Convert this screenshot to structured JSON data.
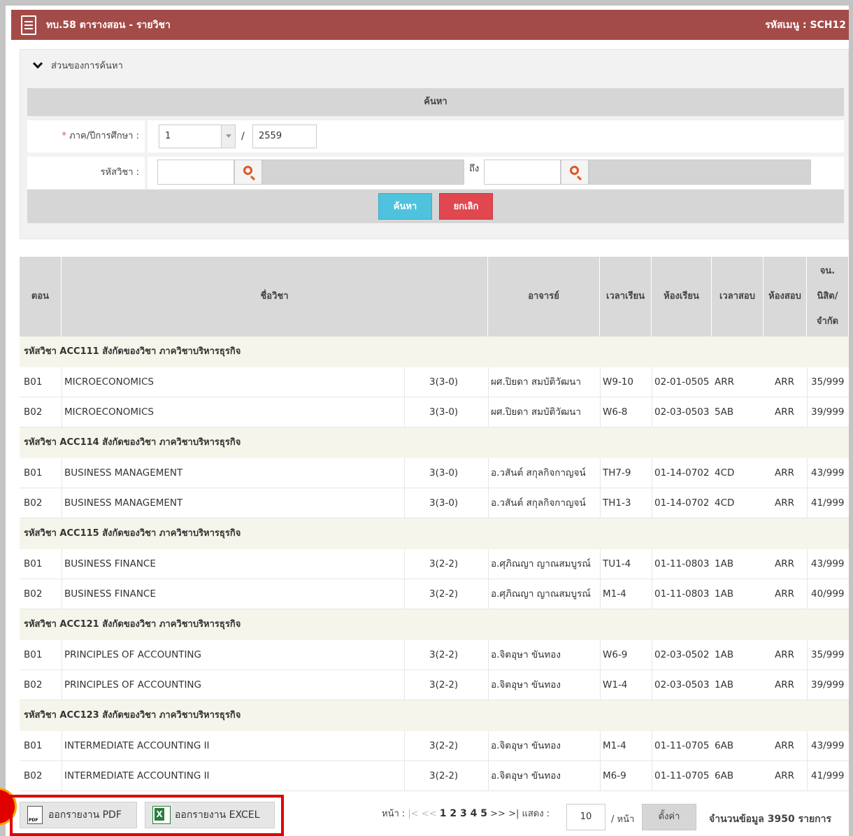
{
  "header": {
    "title": "ทบ.58 ตารางสอน - รายวิชา",
    "menu_code": "รหัสเมนู : SCH12"
  },
  "search": {
    "collapse_label": "ส่วนของการค้นหา",
    "section_title": "ค้นหา",
    "term_label": "ภาค/ปีการศึกษา :",
    "required_mark": "*",
    "term_value": "1",
    "slash": "/",
    "year_value": "2559",
    "course_code_label": "รหัสวิชา :",
    "to_label": "ถึง",
    "search_button": "ค้นหา",
    "cancel_button": "ยกเลิก"
  },
  "table": {
    "headers": {
      "section": "ตอน",
      "course_name": "ชื่อวิชา",
      "instructor": "อาจารย์",
      "class_time": "เวลาเรียน",
      "room": "ห้องเรียน",
      "exam_time": "เวลาสอบ",
      "exam_room": "ห้องสอบ",
      "count_1": "จน.",
      "count_2": "นิสิต/",
      "count_3": "จำกัด"
    },
    "groups": [
      {
        "label": "รหัสวิชา ACC111 สังกัดของวิชา ภาควิชาบริหารธุรกิจ",
        "rows": [
          {
            "sec": "B01",
            "name": "MICROECONOMICS",
            "credit": "3(3-0)",
            "teacher": "ผศ.ปิยดา สมบัติวัฒนา",
            "time": "W9-10",
            "room": "02-01-0505",
            "exam": "ARR",
            "exam_room": "ARR",
            "count": "35/999"
          },
          {
            "sec": "B02",
            "name": "MICROECONOMICS",
            "credit": "3(3-0)",
            "teacher": "ผศ.ปิยดา สมบัติวัฒนา",
            "time": "W6-8",
            "room": "02-03-0503",
            "exam": "5AB",
            "exam_room": "ARR",
            "count": "39/999"
          }
        ]
      },
      {
        "label": "รหัสวิชา ACC114 สังกัดของวิชา ภาควิชาบริหารธุรกิจ",
        "rows": [
          {
            "sec": "B01",
            "name": "BUSINESS MANAGEMENT",
            "credit": "3(3-0)",
            "teacher": "อ.วสันต์ สกุลกิจกาญจน์",
            "time": "TH7-9",
            "room": "01-14-0702",
            "exam": "4CD",
            "exam_room": "ARR",
            "count": "43/999"
          },
          {
            "sec": "B02",
            "name": "BUSINESS MANAGEMENT",
            "credit": "3(3-0)",
            "teacher": "อ.วสันต์ สกุลกิจกาญจน์",
            "time": "TH1-3",
            "room": "01-14-0702",
            "exam": "4CD",
            "exam_room": "ARR",
            "count": "41/999"
          }
        ]
      },
      {
        "label": "รหัสวิชา ACC115 สังกัดของวิชา ภาควิชาบริหารธุรกิจ",
        "rows": [
          {
            "sec": "B01",
            "name": "BUSINESS FINANCE",
            "credit": "3(2-2)",
            "teacher": "อ.ศุภิณญา ญาณสมบูรณ์",
            "time": "TU1-4",
            "room": "01-11-0803",
            "exam": "1AB",
            "exam_room": "ARR",
            "count": "43/999"
          },
          {
            "sec": "B02",
            "name": "BUSINESS FINANCE",
            "credit": "3(2-2)",
            "teacher": "อ.ศุภิณญา ญาณสมบูรณ์",
            "time": "M1-4",
            "room": "01-11-0803",
            "exam": "1AB",
            "exam_room": "ARR",
            "count": "40/999"
          }
        ]
      },
      {
        "label": "รหัสวิชา ACC121 สังกัดของวิชา ภาควิชาบริหารธุรกิจ",
        "rows": [
          {
            "sec": "B01",
            "name": "PRINCIPLES OF ACCOUNTING",
            "credit": "3(2-2)",
            "teacher": "อ.จิตอุษา ขันทอง",
            "time": "W6-9",
            "room": "02-03-0502",
            "exam": "1AB",
            "exam_room": "ARR",
            "count": "35/999"
          },
          {
            "sec": "B02",
            "name": "PRINCIPLES OF ACCOUNTING",
            "credit": "3(2-2)",
            "teacher": "อ.จิตอุษา ขันทอง",
            "time": "W1-4",
            "room": "02-03-0503",
            "exam": "1AB",
            "exam_room": "ARR",
            "count": "39/999"
          }
        ]
      },
      {
        "label": "รหัสวิชา ACC123 สังกัดของวิชา ภาควิชาบริหารธุรกิจ",
        "rows": [
          {
            "sec": "B01",
            "name": "INTERMEDIATE ACCOUNTING II",
            "credit": "3(2-2)",
            "teacher": "อ.จิตอุษา ขันทอง",
            "time": "M1-4",
            "room": "01-11-0705",
            "exam": "6AB",
            "exam_room": "ARR",
            "count": "43/999"
          },
          {
            "sec": "B02",
            "name": "INTERMEDIATE ACCOUNTING II",
            "credit": "3(2-2)",
            "teacher": "อ.จิตอุษา ขันทอง",
            "time": "M6-9",
            "room": "01-11-0705",
            "exam": "6AB",
            "exam_room": "ARR",
            "count": "41/999"
          }
        ]
      }
    ]
  },
  "footer": {
    "export_pdf": "ออกรายงาน PDF",
    "export_excel": "ออกรายงาน EXCEL",
    "page_label": "หน้า :",
    "first": "|<",
    "prev": "<<",
    "pages": "1 2 3 4 5",
    "next": ">>",
    "last": ">|",
    "show_label": "แสดง :",
    "per_page": "10",
    "per_page_suffix": "/ หน้า",
    "set_button": "ตั้งค่า",
    "total": "จำนวนข้อมูล 3950 รายการ"
  },
  "colors": {
    "title_bar": "#a34b48",
    "search_button": "#4fc2dd",
    "cancel_button": "#e0474f",
    "highlight": "#e00000"
  }
}
